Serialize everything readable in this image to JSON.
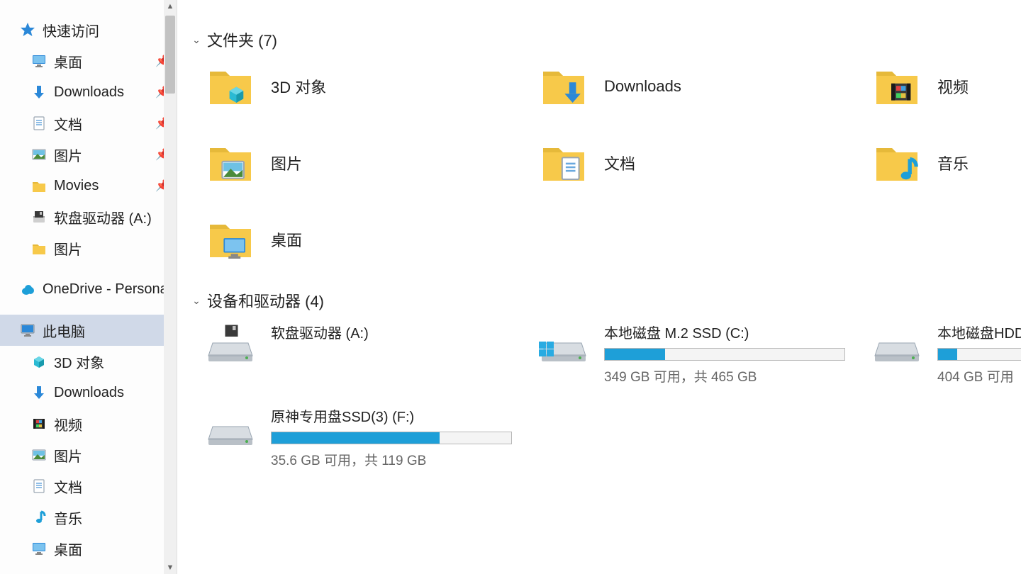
{
  "sidebar": {
    "quick_access": "快速访问",
    "items": [
      {
        "label": "桌面",
        "pinned": true
      },
      {
        "label": "Downloads",
        "pinned": true
      },
      {
        "label": "文档",
        "pinned": true
      },
      {
        "label": "图片",
        "pinned": true
      },
      {
        "label": "Movies",
        "pinned": true
      },
      {
        "label": "软盘驱动器 (A:)",
        "pinned": false
      },
      {
        "label": "图片",
        "pinned": false
      }
    ],
    "onedrive": "OneDrive - Personal",
    "this_pc": "此电脑",
    "pc_items": [
      {
        "label": "3D 对象"
      },
      {
        "label": "Downloads"
      },
      {
        "label": "视频"
      },
      {
        "label": "图片"
      },
      {
        "label": "文档"
      },
      {
        "label": "音乐"
      },
      {
        "label": "桌面"
      }
    ]
  },
  "main": {
    "folders": {
      "header": "文件夹 (7)",
      "items": [
        {
          "name": "3D 对象"
        },
        {
          "name": "Downloads"
        },
        {
          "name": "视频"
        },
        {
          "name": "图片"
        },
        {
          "name": "文档"
        },
        {
          "name": "音乐"
        },
        {
          "name": "桌面"
        }
      ]
    },
    "drives": {
      "header": "设备和驱动器 (4)",
      "items": [
        {
          "name": "软盘驱动器 (A:)",
          "free_text": "",
          "fill_pct": 0,
          "has_bar": false
        },
        {
          "name": "本地磁盘 M.2 SSD (C:)",
          "free_text": "349 GB 可用，共 465 GB",
          "fill_pct": 25,
          "has_bar": true
        },
        {
          "name": "本地磁盘HDD",
          "free_text": "404 GB 可用",
          "fill_pct": 8,
          "has_bar": true
        },
        {
          "name": "原神专用盘SSD(3) (F:)",
          "free_text": "35.6 GB 可用，共 119 GB",
          "fill_pct": 70,
          "has_bar": true
        }
      ]
    }
  }
}
